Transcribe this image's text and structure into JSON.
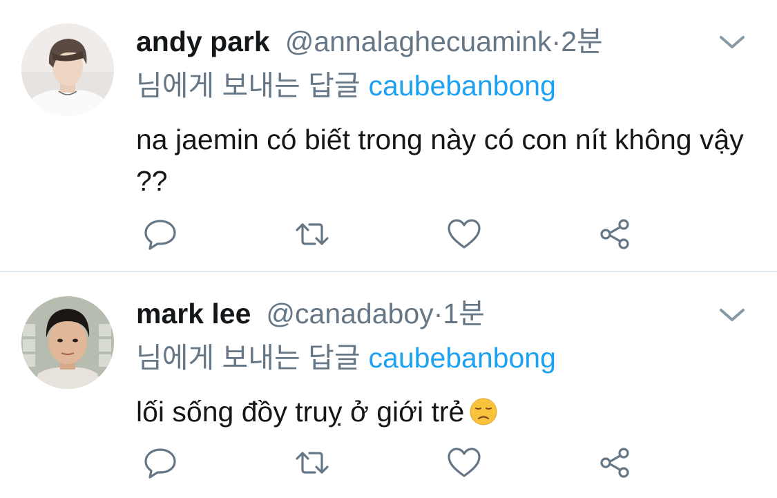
{
  "tweets": [
    {
      "display_name": "andy park",
      "handle": "@annalaghecuamink",
      "separator": "·",
      "time": "2분",
      "reply_prefix": "님에게 보내는 답글",
      "reply_to": "caubebanbong",
      "text": "na jaemin có biết trong này có con nít không vậy ??",
      "avatar_icon": "avatar-andy-park",
      "emoji": ""
    },
    {
      "display_name": "mark lee",
      "handle": "@canadaboy",
      "separator": "·",
      "time": "1분",
      "reply_prefix": "님에게 보내는 답글",
      "reply_to": "caubebanbong",
      "text": "lối sống đồy truỵ ở giới trẻ",
      "avatar_icon": "avatar-mark-lee",
      "emoji": "disappointed-face-emoji"
    }
  ],
  "actions": [
    "reply-icon",
    "retweet-icon",
    "like-icon",
    "share-icon"
  ],
  "colors": {
    "text": "#14171a",
    "secondary": "#657786",
    "link": "#1da1f2",
    "icon": "#657786",
    "divider": "#e1e8ed"
  }
}
